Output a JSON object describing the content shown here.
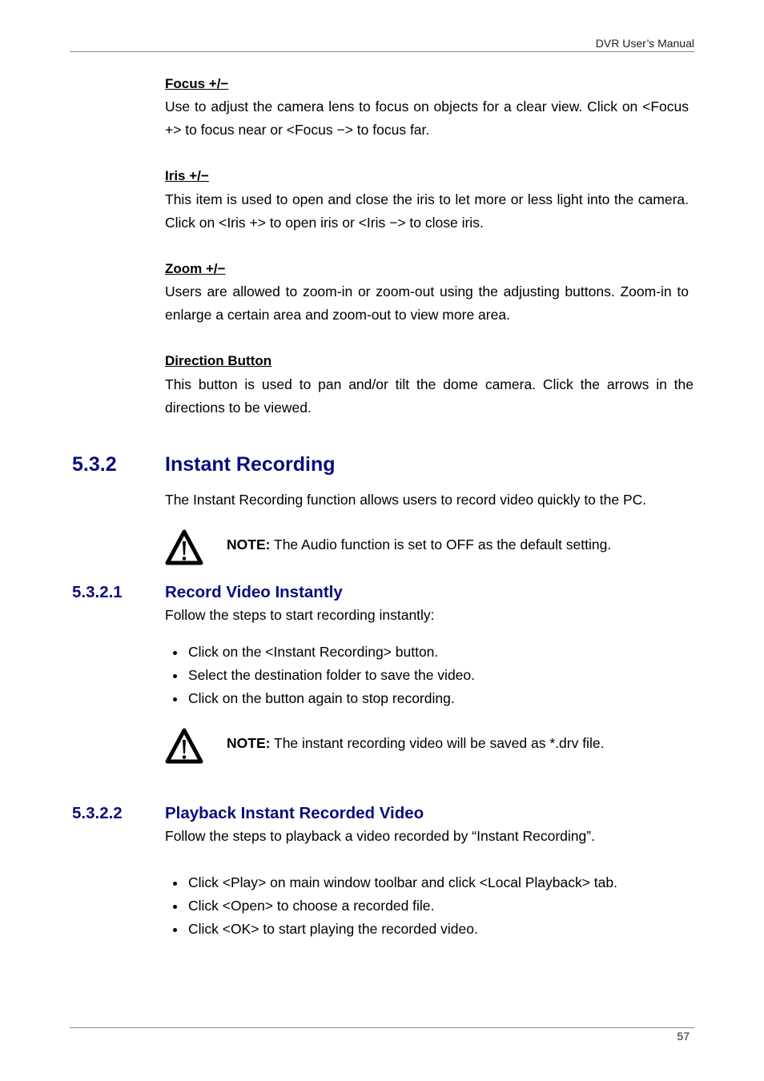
{
  "header": {
    "title": "DVR User’s Manual"
  },
  "footer": {
    "page_number": "57"
  },
  "subsections": [
    {
      "title": "Focus +/−",
      "text": "Use to adjust the camera lens to focus on objects for a clear view. Click on <Focus +> to focus near or <Focus −> to focus far."
    },
    {
      "title": "Iris +/−",
      "text": "This item is used to open and close the iris to let more or less light into the camera. Click on <Iris +> to open iris or <Iris −> to close iris."
    },
    {
      "title": "Zoom +/−",
      "text": "Users are allowed to zoom-in or zoom-out using the adjusting buttons. Zoom-in to enlarge a certain area and zoom-out to view more area."
    },
    {
      "title": "Direction Button",
      "text": "This button is used to pan and/or tilt the dome camera. Click the arrows in the directions to be viewed."
    }
  ],
  "section": {
    "number": "5.3.2",
    "title": "Instant Recording",
    "intro": "The Instant Recording function allows users to record video quickly to the PC.",
    "note": {
      "label": "NOTE:",
      "text": " The Audio function is set to OFF as the default setting.",
      "icon": "warning-triangle-icon"
    }
  },
  "subsection_1": {
    "number": "5.3.2.1",
    "title": "Record Video Instantly",
    "intro": "Follow the steps to start recording instantly:",
    "steps": [
      "Click on the <Instant Recording> button.",
      "Select the destination folder to save the video.",
      "Click on the button again to stop recording."
    ],
    "note": {
      "label": "NOTE:",
      "text": " The instant recording video will be saved as *.drv file.",
      "icon": "warning-triangle-icon"
    }
  },
  "subsection_2": {
    "number": "5.3.2.2",
    "title": "Playback Instant Recorded Video",
    "intro": "Follow the steps to playback a video recorded by “Instant Recording”.",
    "steps": [
      "Click <Play> on main window toolbar and click <Local Playback> tab.",
      "Click <Open> to choose a recorded file.",
      "Click <OK> to start playing the recorded video."
    ]
  }
}
